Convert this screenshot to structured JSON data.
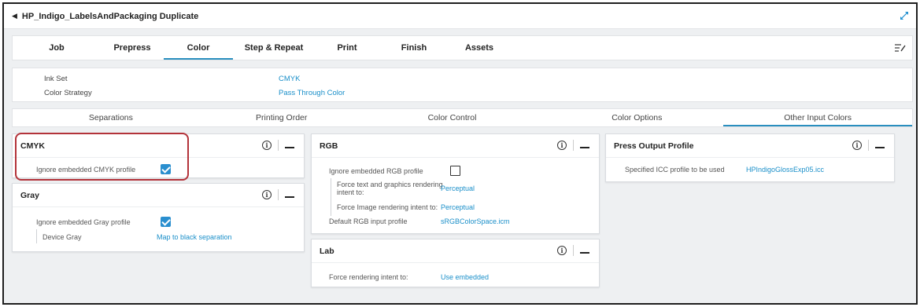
{
  "window": {
    "title": "HP_Indigo_LabelsAndPackaging Duplicate"
  },
  "tabs": [
    {
      "label": "Job",
      "active": false
    },
    {
      "label": "Prepress",
      "active": false
    },
    {
      "label": "Color",
      "active": true
    },
    {
      "label": "Step & Repeat",
      "active": false
    },
    {
      "label": "Print",
      "active": false
    },
    {
      "label": "Finish",
      "active": false
    },
    {
      "label": "Assets",
      "active": false
    }
  ],
  "info": {
    "ink_set_label": "Ink Set",
    "ink_set_value": "CMYK",
    "color_strategy_label": "Color Strategy",
    "color_strategy_value": "Pass Through Color"
  },
  "subtabs": [
    {
      "label": "Separations",
      "active": false
    },
    {
      "label": "Printing Order",
      "active": false
    },
    {
      "label": "Color Control",
      "active": false
    },
    {
      "label": "Color Options",
      "active": false
    },
    {
      "label": "Other Input Colors",
      "active": true
    }
  ],
  "panels": {
    "cmyk": {
      "title": "CMYK",
      "ignore_label": "Ignore embedded CMYK profile",
      "ignore_checked": true
    },
    "gray": {
      "title": "Gray",
      "ignore_label": "Ignore embedded Gray profile",
      "ignore_checked": true,
      "device_gray_label": "Device Gray",
      "device_gray_value": "Map to black separation"
    },
    "rgb": {
      "title": "RGB",
      "ignore_label": "Ignore embedded RGB profile",
      "ignore_checked": false,
      "force_text_label_1": "Force text and graphics rendering",
      "force_text_label_2": "intent to:",
      "force_text_value": "Perceptual",
      "force_image_label": "Force Image rendering intent to:",
      "force_image_value": "Perceptual",
      "default_rgb_label": "Default RGB input profile",
      "default_rgb_value": "sRGBColorSpace.icm"
    },
    "lab": {
      "title": "Lab",
      "force_label": "Force rendering intent to:",
      "force_value": "Use embedded"
    },
    "press": {
      "title": "Press Output Profile",
      "icc_label": "Specified ICC profile to be used",
      "icc_value": "HPIndigoGlossExp05.icc"
    }
  },
  "colors": {
    "accent": "#2a8fbf",
    "link": "#1a8fc9",
    "highlight_box": "#b3333a"
  }
}
